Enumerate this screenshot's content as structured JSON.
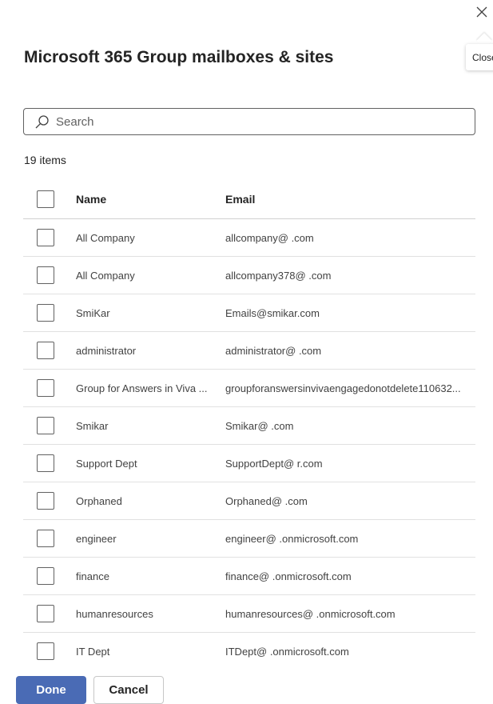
{
  "dialog": {
    "title": "Microsoft 365 Group mailboxes & sites",
    "close_tooltip": "Close"
  },
  "search": {
    "placeholder": "Search",
    "value": "",
    "icon": "search-icon"
  },
  "item_count": "19 items",
  "table": {
    "columns": [
      "Name",
      "Email"
    ],
    "rows": [
      {
        "name": "All Company",
        "email": "allcompany@                .com"
      },
      {
        "name": "All Company",
        "email": "allcompany378@              .com"
      },
      {
        "name": "SmiKar",
        "email": "Emails@smikar.com"
      },
      {
        "name": "administrator",
        "email": "administrator@            .com"
      },
      {
        "name": "Group for Answers in Viva ...",
        "email": "groupforanswersinvivaengagedonotdelete110632..."
      },
      {
        "name": "Smikar",
        "email": "Smikar@              .com"
      },
      {
        "name": "Support Dept",
        "email": "SupportDept@           r.com"
      },
      {
        "name": "Orphaned",
        "email": "Orphaned@              .com"
      },
      {
        "name": "engineer",
        "email": "engineer@               .onmicrosoft.com"
      },
      {
        "name": "finance",
        "email": "finance@               .onmicrosoft.com"
      },
      {
        "name": "humanresources",
        "email": "humanresources@              .onmicrosoft.com"
      },
      {
        "name": "IT Dept",
        "email": "ITDept@               .onmicrosoft.com"
      }
    ]
  },
  "footer": {
    "done_label": "Done",
    "cancel_label": "Cancel"
  },
  "colors": {
    "primary": "#4a6bb5",
    "text": "#242424",
    "border": "#e1e1e1"
  }
}
